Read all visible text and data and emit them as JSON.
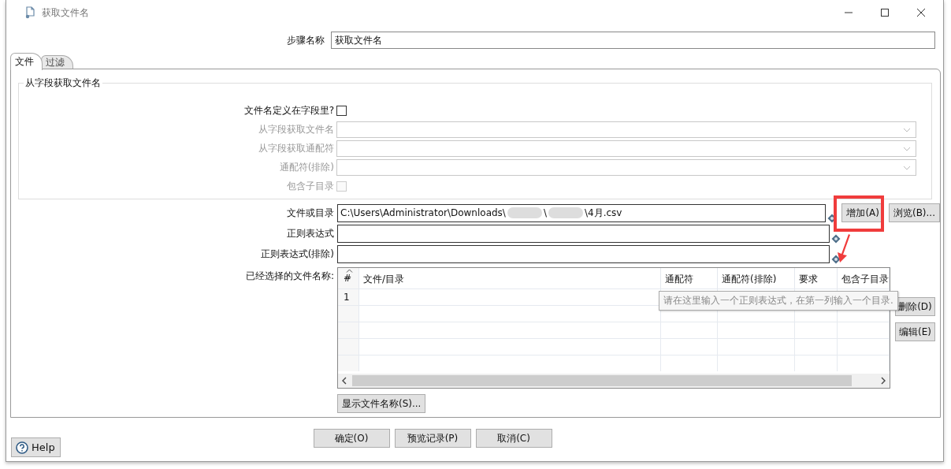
{
  "window": {
    "title": "获取文件名"
  },
  "step_name": {
    "label": "步骤名称",
    "value": "获取文件名"
  },
  "tabs": [
    {
      "label": "文件",
      "selected": true
    },
    {
      "label": "过滤",
      "selected": false
    }
  ],
  "group": {
    "title": "从字段获取文件名",
    "rows": [
      {
        "kind": "checkbox",
        "label": "文件名定义在字段里?",
        "checked": false,
        "disabled": false
      },
      {
        "kind": "combo",
        "label": "从字段获取文件名",
        "disabled": true
      },
      {
        "kind": "combo",
        "label": "从字段获取通配符",
        "disabled": true
      },
      {
        "kind": "combo",
        "label": "通配符(排除)",
        "disabled": true
      },
      {
        "kind": "checkbox",
        "label": "包含子目录",
        "checked": false,
        "disabled": true
      }
    ]
  },
  "file_rows": [
    {
      "label": "文件或目录",
      "path_parts": [
        "C:\\Users\\Administrator\\Downloads\\",
        "\\",
        "\\4月.csv"
      ]
    },
    {
      "label": "正则表达式"
    },
    {
      "label": "正则表达式(排除)"
    }
  ],
  "add_button": {
    "label": "增加(A)",
    "highlighted": true
  },
  "browse_button": "浏览(B)...",
  "arrow_annotation": true,
  "table": {
    "label": "已经选择的文件名称:",
    "columns": [
      "#",
      "文件/目录",
      "通配符",
      "通配符(排除)",
      "要求",
      "包含子目录"
    ],
    "rows": [
      {
        "number": "1"
      }
    ]
  },
  "side_buttons": [
    "删除(D)",
    "编辑(E)"
  ],
  "tooltip": "请在这里输入一个正则表达式，在第一列输入一个目录.",
  "show_button": "显示文件名称(S)...",
  "footer_buttons": [
    "确定(O)",
    "预览记录(P)",
    "取消(C)"
  ],
  "help_button": "Help"
}
